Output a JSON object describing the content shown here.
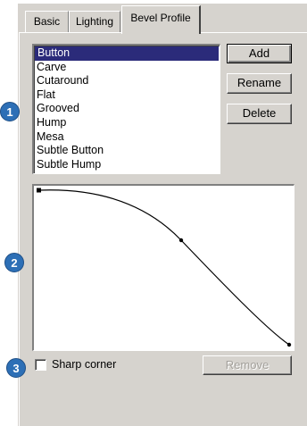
{
  "tabs": [
    {
      "label": "Basic",
      "active": false
    },
    {
      "label": "Lighting",
      "active": false
    },
    {
      "label": "Bevel Profile",
      "active": true
    }
  ],
  "profiles": {
    "items": [
      "Button",
      "Carve",
      "Cutaround",
      "Flat",
      "Grooved",
      "Hump",
      "Mesa",
      "Subtle Button",
      "Subtle Hump"
    ],
    "selected": "Button"
  },
  "buttons": {
    "add": "Add",
    "rename": "Rename",
    "delete": "Delete",
    "remove": "Remove"
  },
  "sharp_corner": {
    "label": "Sharp corner",
    "checked": false
  },
  "callouts": [
    "1",
    "2",
    "3"
  ],
  "colors": {
    "panel": "#d6d3ce",
    "selection": "#2b2b7a",
    "callout": "#2d6fb6"
  }
}
